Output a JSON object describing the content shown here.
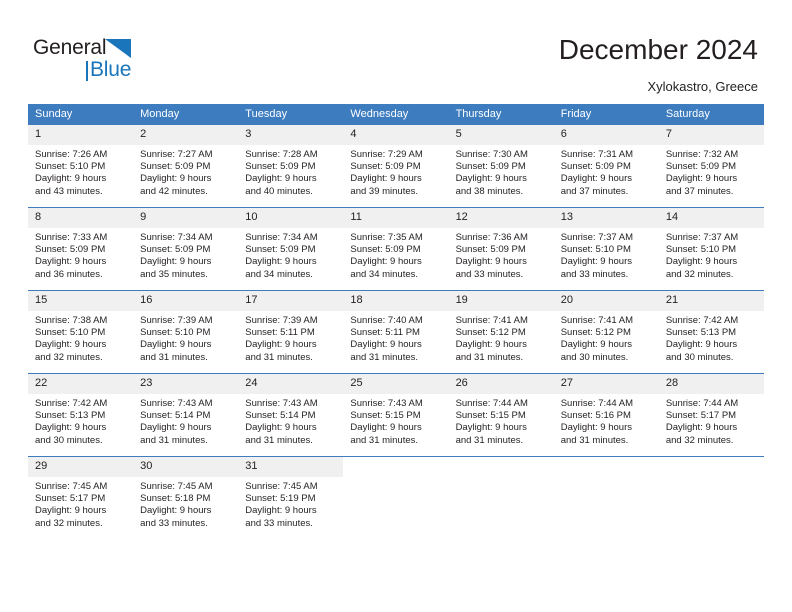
{
  "brand": {
    "name_part1": "General",
    "name_part2": "Blue",
    "triangle_color": "#1b75bb",
    "text_color": "#231f20"
  },
  "header": {
    "title": "December 2024",
    "subtitle": "Xylokastro, Greece"
  },
  "calendar": {
    "header_bg": "#3c7cbf",
    "header_text_color": "#ffffff",
    "daynum_bg": "#f0f0f0",
    "weekdays": [
      "Sunday",
      "Monday",
      "Tuesday",
      "Wednesday",
      "Thursday",
      "Friday",
      "Saturday"
    ],
    "weeks": [
      [
        {
          "day": "1",
          "sunrise": "Sunrise: 7:26 AM",
          "sunset": "Sunset: 5:10 PM",
          "daylight1": "Daylight: 9 hours",
          "daylight2": "and 43 minutes."
        },
        {
          "day": "2",
          "sunrise": "Sunrise: 7:27 AM",
          "sunset": "Sunset: 5:09 PM",
          "daylight1": "Daylight: 9 hours",
          "daylight2": "and 42 minutes."
        },
        {
          "day": "3",
          "sunrise": "Sunrise: 7:28 AM",
          "sunset": "Sunset: 5:09 PM",
          "daylight1": "Daylight: 9 hours",
          "daylight2": "and 40 minutes."
        },
        {
          "day": "4",
          "sunrise": "Sunrise: 7:29 AM",
          "sunset": "Sunset: 5:09 PM",
          "daylight1": "Daylight: 9 hours",
          "daylight2": "and 39 minutes."
        },
        {
          "day": "5",
          "sunrise": "Sunrise: 7:30 AM",
          "sunset": "Sunset: 5:09 PM",
          "daylight1": "Daylight: 9 hours",
          "daylight2": "and 38 minutes."
        },
        {
          "day": "6",
          "sunrise": "Sunrise: 7:31 AM",
          "sunset": "Sunset: 5:09 PM",
          "daylight1": "Daylight: 9 hours",
          "daylight2": "and 37 minutes."
        },
        {
          "day": "7",
          "sunrise": "Sunrise: 7:32 AM",
          "sunset": "Sunset: 5:09 PM",
          "daylight1": "Daylight: 9 hours",
          "daylight2": "and 37 minutes."
        }
      ],
      [
        {
          "day": "8",
          "sunrise": "Sunrise: 7:33 AM",
          "sunset": "Sunset: 5:09 PM",
          "daylight1": "Daylight: 9 hours",
          "daylight2": "and 36 minutes."
        },
        {
          "day": "9",
          "sunrise": "Sunrise: 7:34 AM",
          "sunset": "Sunset: 5:09 PM",
          "daylight1": "Daylight: 9 hours",
          "daylight2": "and 35 minutes."
        },
        {
          "day": "10",
          "sunrise": "Sunrise: 7:34 AM",
          "sunset": "Sunset: 5:09 PM",
          "daylight1": "Daylight: 9 hours",
          "daylight2": "and 34 minutes."
        },
        {
          "day": "11",
          "sunrise": "Sunrise: 7:35 AM",
          "sunset": "Sunset: 5:09 PM",
          "daylight1": "Daylight: 9 hours",
          "daylight2": "and 34 minutes."
        },
        {
          "day": "12",
          "sunrise": "Sunrise: 7:36 AM",
          "sunset": "Sunset: 5:09 PM",
          "daylight1": "Daylight: 9 hours",
          "daylight2": "and 33 minutes."
        },
        {
          "day": "13",
          "sunrise": "Sunrise: 7:37 AM",
          "sunset": "Sunset: 5:10 PM",
          "daylight1": "Daylight: 9 hours",
          "daylight2": "and 33 minutes."
        },
        {
          "day": "14",
          "sunrise": "Sunrise: 7:37 AM",
          "sunset": "Sunset: 5:10 PM",
          "daylight1": "Daylight: 9 hours",
          "daylight2": "and 32 minutes."
        }
      ],
      [
        {
          "day": "15",
          "sunrise": "Sunrise: 7:38 AM",
          "sunset": "Sunset: 5:10 PM",
          "daylight1": "Daylight: 9 hours",
          "daylight2": "and 32 minutes."
        },
        {
          "day": "16",
          "sunrise": "Sunrise: 7:39 AM",
          "sunset": "Sunset: 5:10 PM",
          "daylight1": "Daylight: 9 hours",
          "daylight2": "and 31 minutes."
        },
        {
          "day": "17",
          "sunrise": "Sunrise: 7:39 AM",
          "sunset": "Sunset: 5:11 PM",
          "daylight1": "Daylight: 9 hours",
          "daylight2": "and 31 minutes."
        },
        {
          "day": "18",
          "sunrise": "Sunrise: 7:40 AM",
          "sunset": "Sunset: 5:11 PM",
          "daylight1": "Daylight: 9 hours",
          "daylight2": "and 31 minutes."
        },
        {
          "day": "19",
          "sunrise": "Sunrise: 7:41 AM",
          "sunset": "Sunset: 5:12 PM",
          "daylight1": "Daylight: 9 hours",
          "daylight2": "and 31 minutes."
        },
        {
          "day": "20",
          "sunrise": "Sunrise: 7:41 AM",
          "sunset": "Sunset: 5:12 PM",
          "daylight1": "Daylight: 9 hours",
          "daylight2": "and 30 minutes."
        },
        {
          "day": "21",
          "sunrise": "Sunrise: 7:42 AM",
          "sunset": "Sunset: 5:13 PM",
          "daylight1": "Daylight: 9 hours",
          "daylight2": "and 30 minutes."
        }
      ],
      [
        {
          "day": "22",
          "sunrise": "Sunrise: 7:42 AM",
          "sunset": "Sunset: 5:13 PM",
          "daylight1": "Daylight: 9 hours",
          "daylight2": "and 30 minutes."
        },
        {
          "day": "23",
          "sunrise": "Sunrise: 7:43 AM",
          "sunset": "Sunset: 5:14 PM",
          "daylight1": "Daylight: 9 hours",
          "daylight2": "and 31 minutes."
        },
        {
          "day": "24",
          "sunrise": "Sunrise: 7:43 AM",
          "sunset": "Sunset: 5:14 PM",
          "daylight1": "Daylight: 9 hours",
          "daylight2": "and 31 minutes."
        },
        {
          "day": "25",
          "sunrise": "Sunrise: 7:43 AM",
          "sunset": "Sunset: 5:15 PM",
          "daylight1": "Daylight: 9 hours",
          "daylight2": "and 31 minutes."
        },
        {
          "day": "26",
          "sunrise": "Sunrise: 7:44 AM",
          "sunset": "Sunset: 5:15 PM",
          "daylight1": "Daylight: 9 hours",
          "daylight2": "and 31 minutes."
        },
        {
          "day": "27",
          "sunrise": "Sunrise: 7:44 AM",
          "sunset": "Sunset: 5:16 PM",
          "daylight1": "Daylight: 9 hours",
          "daylight2": "and 31 minutes."
        },
        {
          "day": "28",
          "sunrise": "Sunrise: 7:44 AM",
          "sunset": "Sunset: 5:17 PM",
          "daylight1": "Daylight: 9 hours",
          "daylight2": "and 32 minutes."
        }
      ],
      [
        {
          "day": "29",
          "sunrise": "Sunrise: 7:45 AM",
          "sunset": "Sunset: 5:17 PM",
          "daylight1": "Daylight: 9 hours",
          "daylight2": "and 32 minutes."
        },
        {
          "day": "30",
          "sunrise": "Sunrise: 7:45 AM",
          "sunset": "Sunset: 5:18 PM",
          "daylight1": "Daylight: 9 hours",
          "daylight2": "and 33 minutes."
        },
        {
          "day": "31",
          "sunrise": "Sunrise: 7:45 AM",
          "sunset": "Sunset: 5:19 PM",
          "daylight1": "Daylight: 9 hours",
          "daylight2": "and 33 minutes."
        },
        {
          "day": "",
          "sunrise": "",
          "sunset": "",
          "daylight1": "",
          "daylight2": ""
        },
        {
          "day": "",
          "sunrise": "",
          "sunset": "",
          "daylight1": "",
          "daylight2": ""
        },
        {
          "day": "",
          "sunrise": "",
          "sunset": "",
          "daylight1": "",
          "daylight2": ""
        },
        {
          "day": "",
          "sunrise": "",
          "sunset": "",
          "daylight1": "",
          "daylight2": ""
        }
      ]
    ]
  }
}
